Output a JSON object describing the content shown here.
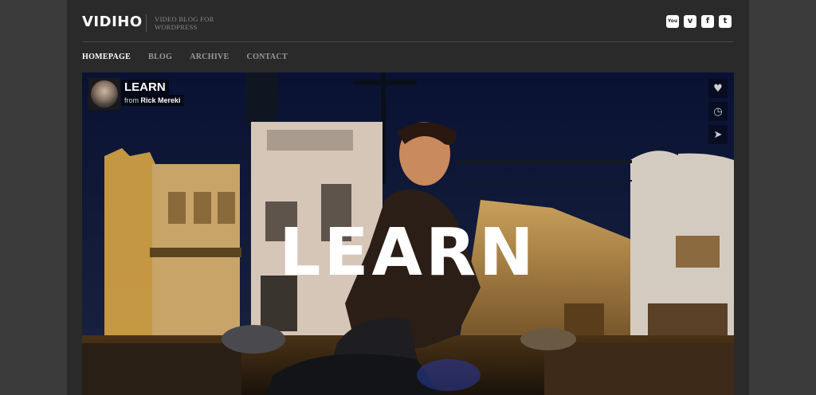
{
  "header": {
    "logo": "VIDIHO",
    "tagline": "VIDEO BLOG FOR WORDPRESS",
    "social": [
      {
        "icon": "youtube-icon",
        "glyph": "You"
      },
      {
        "icon": "vimeo-icon",
        "glyph": "v"
      },
      {
        "icon": "facebook-icon",
        "glyph": "f"
      },
      {
        "icon": "twitter-icon",
        "glyph": "t"
      }
    ]
  },
  "nav": {
    "items": [
      "HOMEPAGE",
      "BLOG",
      "ARCHIVE",
      "CONTACT"
    ],
    "active": "HOMEPAGE"
  },
  "video": {
    "title": "LEARN",
    "from_prefix": "from",
    "author": "Rick Mereki",
    "overlay_text": "LEARN",
    "actions": [
      {
        "icon": "heart-icon",
        "glyph": "♥"
      },
      {
        "icon": "clock-icon",
        "glyph": "◷"
      },
      {
        "icon": "send-icon",
        "glyph": "➤"
      }
    ]
  },
  "colors": {
    "page_bg": "#2a2a2a",
    "outer_bg": "#3b3b3b",
    "sky": "#0f1734",
    "text_white": "#ffffff",
    "text_muted": "#9a9a9a"
  }
}
